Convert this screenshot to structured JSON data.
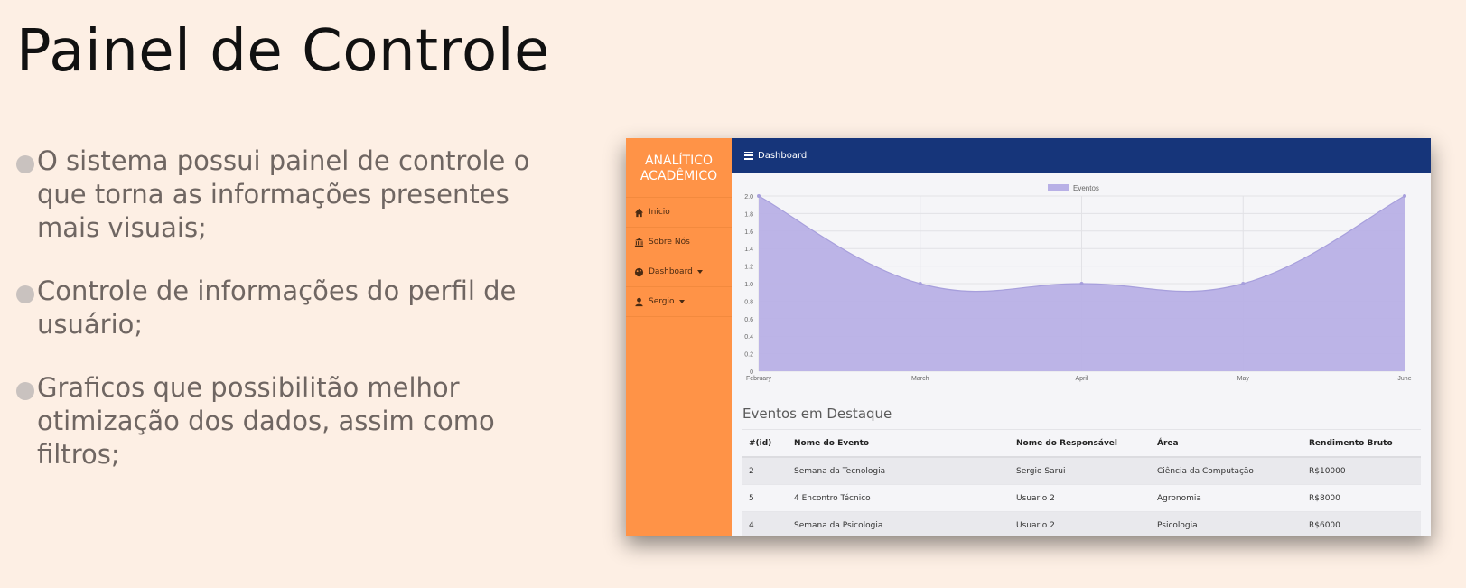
{
  "slide": {
    "title": "Painel de Controle",
    "bullets": [
      "O sistema possui painel de controle o que torna as informações presentes mais visuais;",
      "Controle de informações do perfil de usuário;",
      "Graficos que possibilitão melhor otimização dos dados, assim como filtros;"
    ]
  },
  "app": {
    "brand_line1": "ANALÍTICO",
    "brand_line2": "ACADÊMICO",
    "sidebar": [
      {
        "label": "Inicio",
        "icon": "home-icon"
      },
      {
        "label": "Sobre Nós",
        "icon": "bank-icon"
      },
      {
        "label": "Dashboard",
        "icon": "palette-icon"
      },
      {
        "label": "Sergio",
        "icon": "user-icon"
      }
    ],
    "topbar_title": "Dashboard",
    "table_title": "Eventos em Destaque",
    "table": {
      "headers": [
        "#(id)",
        "Nome do Evento",
        "Nome do Responsável",
        "Área",
        "Rendimento Bruto"
      ],
      "rows": [
        [
          "2",
          "Semana da Tecnologia",
          "Sergio Sarui",
          "Ciência da Computação",
          "R$10000"
        ],
        [
          "5",
          "4 Encontro Técnico",
          "Usuario 2",
          "Agronomia",
          "R$8000"
        ],
        [
          "4",
          "Semana da Psicologia",
          "Usuario 2",
          "Psicologia",
          "R$6000"
        ]
      ]
    }
  },
  "colors": {
    "sidebar": "#ff9347",
    "topbar": "#16357a",
    "area_fill": "#b8b0e6",
    "area_stroke": "#a79fdc"
  },
  "chart_data": {
    "type": "area",
    "categories": [
      "February",
      "March",
      "April",
      "May",
      "June"
    ],
    "series": [
      {
        "name": "Eventos",
        "values": [
          2.0,
          1.0,
          1.0,
          1.0,
          2.0
        ]
      }
    ],
    "ylim": [
      0,
      2.0
    ],
    "yticks": [
      "0",
      "0.2",
      "0.4",
      "0.6",
      "0.8",
      "1.0",
      "1.2",
      "1.4",
      "1.6",
      "1.8",
      "2.0"
    ],
    "legend": "top-center",
    "grid": true
  }
}
